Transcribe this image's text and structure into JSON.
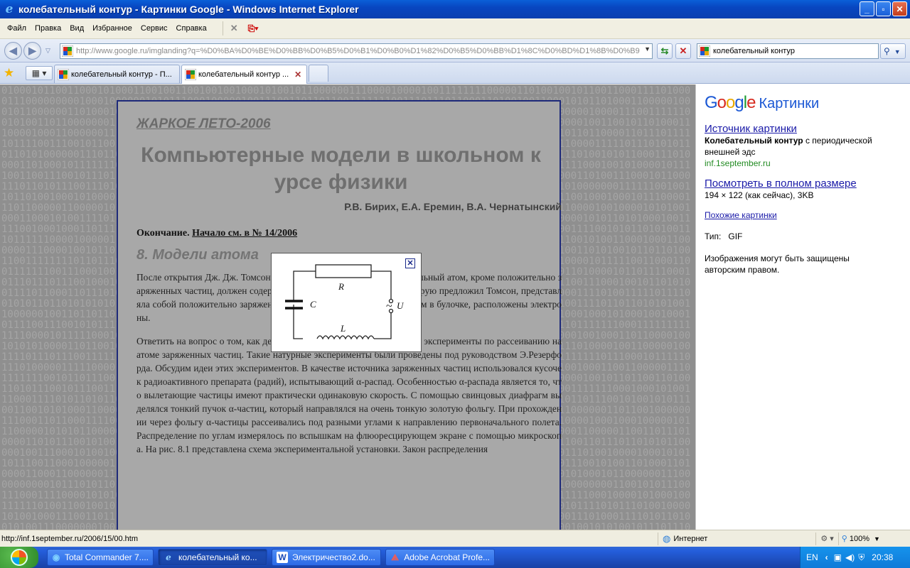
{
  "window": {
    "title": "колебательный контур - Картинки Google - Windows Internet Explorer"
  },
  "menu": [
    "Файл",
    "Правка",
    "Вид",
    "Избранное",
    "Сервис",
    "Справка"
  ],
  "address": {
    "url": "http://www.google.ru/imglanding?q=%D0%BA%D0%BE%D0%BB%D0%B5%D0%B1%D0%B0%D1%82%D0%B5%D0%BB%D1%8C%D0%BD%D1%8B%D0%B9"
  },
  "search": {
    "value": "колебательный контур"
  },
  "tabs": [
    {
      "label": "колебательный контур - П..."
    },
    {
      "label": "колебательный контур ..."
    }
  ],
  "article": {
    "kicker": "ЖАРКОЕ ЛЕТО-2006",
    "title": "Компьютерные модели в школьном курсе физики",
    "authors": "Р.В. Бирих, Е.А. Еремин, В.А. Чернатынский",
    "continuation_prefix": "Окончание.",
    "continuation_link": "Начало см. в № 14/2006",
    "section": "8. Модели атома",
    "para1": "После открытия Дж. Дж. Томсоном электрона стало ясно, что нейтральный атом, кроме положительно заряженных частиц, должен содержать электроны. Модель атома, которую предложил Томсон, представляла собой положительно заряженную сферу, внутри которой, как изюм в булочке, расположены электроны.",
    "para2": "Ответить на вопрос о том, как действительно устроен атом, могли бы эксперименты по рассеиванию на атоме заряженных частиц. Такие натурные эксперименты были проведены под руководством Э.Резерфорда. Обсудим идеи этих экспериментов. В качестве источника заряженных частиц использовался кусочек радиоактивного препарата (радий), испытывающий α-распад. Особенностью α-распада является то, что вылетающие частицы имеют практически одинаковую скорость. С помощью свинцовых диафрагм выделялся тонкий пучок α-частиц, который направлялся на очень тонкую золотую фольгу. При прохождении через фольгу α-частицы рассеивались под разными углами к направлению первоначального полета. Распределение по углам измерялось по вспышкам на флюоресцирующем экране с помощью микроскопа. На рис. 8.1 представлена схема экспериментальной установки. Закон распределения"
  },
  "popup": {
    "labels": {
      "R": "R",
      "C": "C",
      "L": "L",
      "U": "U",
      "tilde": "~"
    }
  },
  "panel": {
    "logo": "Google",
    "logo_sub": "Картинки",
    "source_link": "Источник картинки",
    "desc_bold": "Колебательный контур",
    "desc_rest": " с периодической внешней эдс",
    "domain": "inf.1september.ru",
    "fullsize_link": "Посмотреть в полном размере",
    "size_info": "194 × 122 (как сейчас), 3KB",
    "similar_link": "Похожие картинки",
    "type_label": "Тип:",
    "type_value": "GIF",
    "copyright": "Изображения могут быть защищены авторским правом."
  },
  "status": {
    "url": "http://inf.1september.ru/2006/15/00.htm",
    "zone": "Интернет",
    "zoom": "100%"
  },
  "taskbar": {
    "buttons": [
      {
        "label": "Total Commander 7...."
      },
      {
        "label": "колебательный ко..."
      },
      {
        "label": "Электричество2.do..."
      },
      {
        "label": "Adobe Acrobat Profe..."
      }
    ],
    "lang": "EN",
    "time": "20:38"
  },
  "colors": {
    "titlebar": "#0846c0",
    "article_border": "#1e2a7a",
    "link": "#1a1aa8",
    "domain_green": "#228b22"
  }
}
